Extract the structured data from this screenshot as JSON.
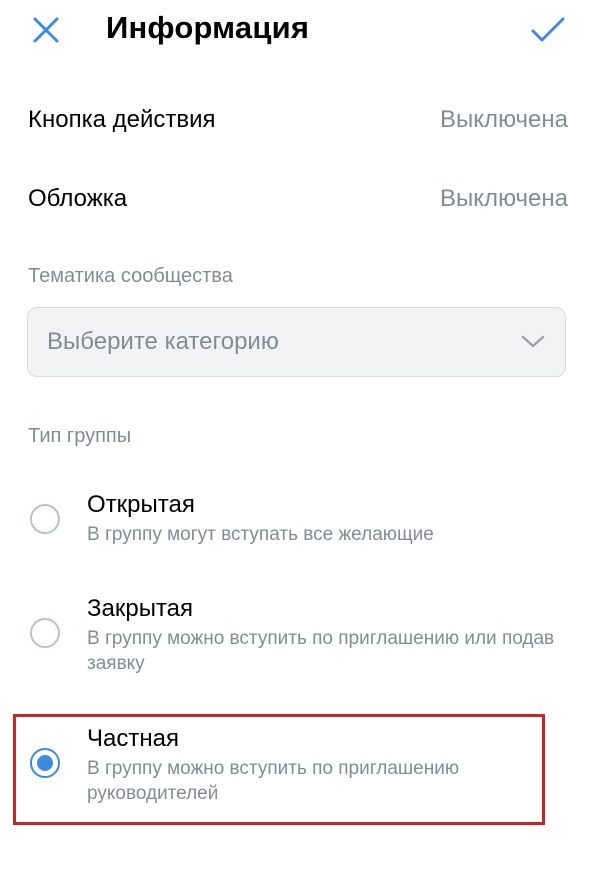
{
  "header": {
    "title": "Информация",
    "close_icon": "close-icon",
    "done_icon": "checkmark-icon"
  },
  "settings": {
    "action_button": {
      "label": "Кнопка действия",
      "value": "Выключена"
    },
    "cover": {
      "label": "Обложка",
      "value": "Выключена"
    }
  },
  "topic": {
    "label": "Тематика сообщества",
    "select_placeholder": "Выберите категорию",
    "chevron_icon": "chevron-down-icon"
  },
  "group_type": {
    "label": "Тип группы",
    "options": [
      {
        "title": "Открытая",
        "description": "В группу могут вступать все желающие",
        "selected": false
      },
      {
        "title": "Закрытая",
        "description": "В группу можно вступить по приглашению или подав заявку",
        "selected": false
      },
      {
        "title": "Частная",
        "description": "В группу можно вступить по приглашению руководителей",
        "selected": true
      }
    ]
  },
  "colors": {
    "accent": "#3f8ae0",
    "secondary_text": "#818c99",
    "highlight_border": "#c62828",
    "select_background": "#f2f3f5"
  }
}
